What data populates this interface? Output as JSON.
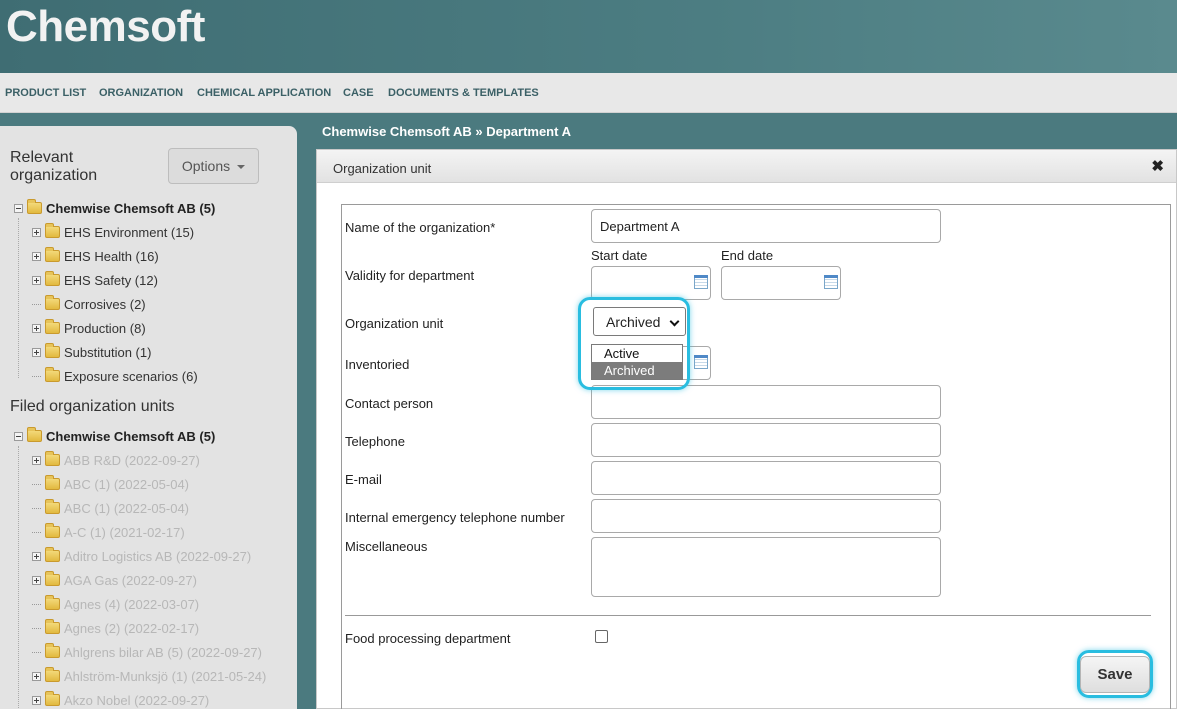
{
  "app": {
    "logo": "Chemsoft"
  },
  "nav": {
    "items": [
      {
        "label": "PRODUCT LIST"
      },
      {
        "label": "ORGANIZATION"
      },
      {
        "label": "CHEMICAL APPLICATION"
      },
      {
        "label": "CASE"
      },
      {
        "label": "DOCUMENTS & TEMPLATES"
      }
    ]
  },
  "sidebar": {
    "relevant_heading_line1": "Relevant",
    "relevant_heading_line2": "organization",
    "options_label": "Options",
    "relevant_root": "Chemwise Chemsoft AB (5)",
    "relevant_items": [
      {
        "label": "EHS Environment (15)",
        "expandable": true
      },
      {
        "label": "EHS Health (16)",
        "expandable": true
      },
      {
        "label": "EHS Safety (12)",
        "expandable": true
      },
      {
        "label": "Corrosives (2)",
        "expandable": false
      },
      {
        "label": "Production (8)",
        "expandable": true
      },
      {
        "label": "Substitution (1)",
        "expandable": true
      },
      {
        "label": "Exposure scenarios (6)",
        "expandable": false
      }
    ],
    "filed_heading": "Filed organization units",
    "filed_root": "Chemwise Chemsoft AB (5)",
    "filed_items": [
      {
        "label": "ABB R&D (2022-09-27)",
        "expandable": true
      },
      {
        "label": "ABC (1) (2022-05-04)",
        "expandable": false
      },
      {
        "label": "ABC (1) (2022-05-04)",
        "expandable": false
      },
      {
        "label": "A-C (1) (2021-02-17)",
        "expandable": false
      },
      {
        "label": "Aditro Logistics AB (2022-09-27)",
        "expandable": true
      },
      {
        "label": "AGA Gas (2022-09-27)",
        "expandable": true
      },
      {
        "label": "Agnes (4) (2022-03-07)",
        "expandable": false
      },
      {
        "label": "Agnes (2) (2022-02-17)",
        "expandable": false
      },
      {
        "label": "Ahlgrens bilar AB (5) (2022-09-27)",
        "expandable": false
      },
      {
        "label": "Ahlström-Munksjö (1) (2021-05-24)",
        "expandable": true
      },
      {
        "label": "Akzo Nobel (2022-09-27)",
        "expandable": true
      }
    ]
  },
  "breadcrumb": "Chemwise Chemsoft AB » Department A",
  "dialog": {
    "title": "Organization unit",
    "close_symbol": "✖",
    "form": {
      "name_label": "Name of the organization*",
      "name_value": "Department A",
      "validity_label": "Validity for department",
      "start_date_label": "Start date",
      "end_date_label": "End date",
      "start_date_value": "",
      "end_date_value": "",
      "org_unit_label": "Organization unit",
      "org_unit_selected": "Archived",
      "org_unit_options": [
        "Active",
        "Archived"
      ],
      "inventoried_label": "Inventoried",
      "contact_label": "Contact person",
      "contact_value": "",
      "telephone_label": "Telephone",
      "telephone_value": "",
      "email_label": "E-mail",
      "email_value": "",
      "emergency_label": "Internal emergency telephone number",
      "emergency_value": "",
      "misc_label": "Miscellaneous",
      "misc_value": "",
      "food_label": "Food processing department",
      "food_checked": false,
      "save_label": "Save"
    }
  },
  "colors": {
    "header_teal": "#4c7d82",
    "nav_text": "#3b6066",
    "highlight": "#29bde0",
    "filed_text": "#b7b7b7"
  }
}
